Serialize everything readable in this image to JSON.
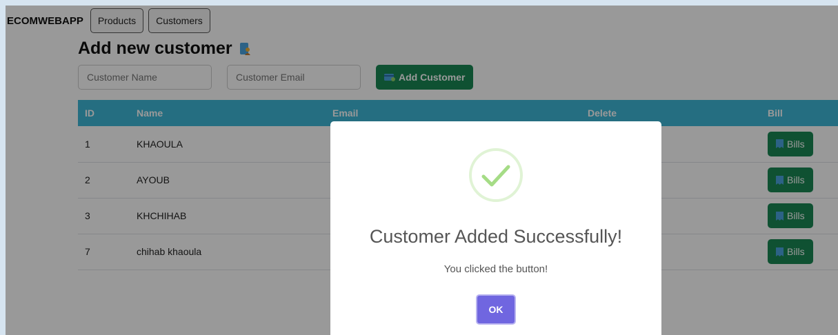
{
  "navbar": {
    "brand": "ECOMWEBAPP",
    "links": [
      "Products",
      "Customers"
    ]
  },
  "page": {
    "title": "Add new customer",
    "title_icon": "person-badge-icon"
  },
  "form": {
    "name_placeholder": "Customer Name",
    "email_placeholder": "Customer Email",
    "add_label": "Add Customer",
    "add_icon": "add-card-icon"
  },
  "table": {
    "headers": [
      "ID",
      "Name",
      "Email",
      "Delete",
      "Bill"
    ],
    "rows": [
      {
        "id": "1",
        "name": "KHAOULA",
        "bill_label": "Bills"
      },
      {
        "id": "2",
        "name": "AYOUB",
        "bill_label": "Bills"
      },
      {
        "id": "3",
        "name": "KHCHIHAB",
        "bill_label": "Bills"
      },
      {
        "id": "7",
        "name": "chihab khaoula",
        "bill_label": "Bills"
      }
    ]
  },
  "modal": {
    "title": "Customer Added Successfully!",
    "text": "You clicked the button!",
    "ok_label": "OK",
    "icon": "success-check-icon"
  },
  "colors": {
    "primary_green": "#198754",
    "table_header": "#3fb8d8",
    "ok_button": "#7066e0",
    "success": "#a5dc86"
  }
}
